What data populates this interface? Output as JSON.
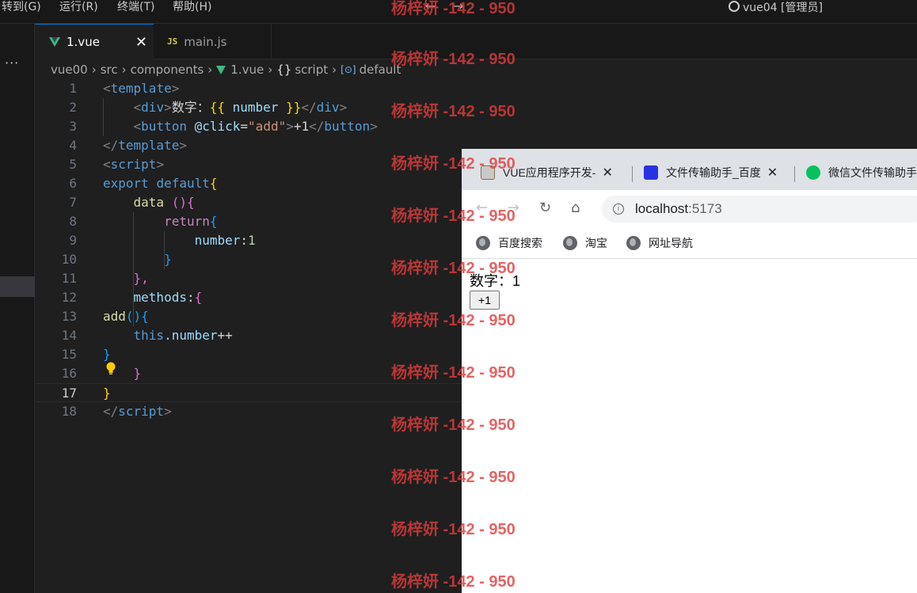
{
  "menubar": {
    "items": [
      "转到(G)",
      "运行(R)",
      "终端(T)",
      "帮助(H)"
    ],
    "back_arrow": "←",
    "forward_arrow": "→",
    "search_text": "vue04 [管理员]"
  },
  "sidebar": {
    "more": "···"
  },
  "tabs": [
    {
      "label": "1.vue",
      "icon": "vue-icon",
      "close": "✕",
      "active": true
    },
    {
      "label": "main.js",
      "icon": "JS",
      "active": false
    }
  ],
  "breadcrumb": {
    "items": [
      "vue00",
      "src",
      "components",
      "1.vue",
      "script",
      "default"
    ],
    "separator": "›",
    "braces": "{}",
    "default_icon": "[⊙]"
  },
  "editor": {
    "line_numbers": [
      "1",
      "2",
      "3",
      "4",
      "5",
      "6",
      "7",
      "8",
      "9",
      "10",
      "11",
      "12",
      "13",
      "14",
      "15",
      "16",
      "17",
      "18"
    ],
    "current_line": 17,
    "tokens": {
      "lt": "<",
      "gt": ">",
      "lt_slash": "</",
      "template": "template",
      "div": "div",
      "button": "button",
      "script": "script",
      "div_text": "数字：",
      "mustache_open": "{{",
      "number_var": " number ",
      "mustache_close": "}}",
      "click_attr": "@click",
      "eq": "=",
      "add_str": "\"add\"",
      "btn_text": "+1",
      "export": "export",
      "default": "default",
      "data": "data",
      "paren_open": "(",
      "paren_close": ")",
      "paren_pair": "()",
      "brace_open": "{",
      "brace_close": "}",
      "brace_comma": "},",
      "return": "return",
      "number_key": "number",
      "colon": ":",
      "one": "1",
      "methods": "methods",
      "add": "add",
      "this": "this",
      "dot_number": ".number",
      "plusplus": "++"
    }
  },
  "browser": {
    "tabs": [
      {
        "label": "VUE应用程序开发-",
        "close": "✕"
      },
      {
        "label": "文件传输助手_百度",
        "close": "✕"
      },
      {
        "label": "微信文件传输助手"
      }
    ],
    "nav": {
      "back": "←",
      "forward": "→",
      "reload": "↻",
      "home": "⌂",
      "info": "i"
    },
    "url_host": "localhost",
    "url_port": ":5173",
    "bookmarks": [
      "百度搜索",
      "淘宝",
      "网址导航"
    ],
    "page": {
      "text": "数字：1",
      "button": "+1"
    }
  },
  "watermark": {
    "text": "杨梓妍 -142 - 950",
    "colors": {
      "watermark": "#de3c3c"
    }
  }
}
